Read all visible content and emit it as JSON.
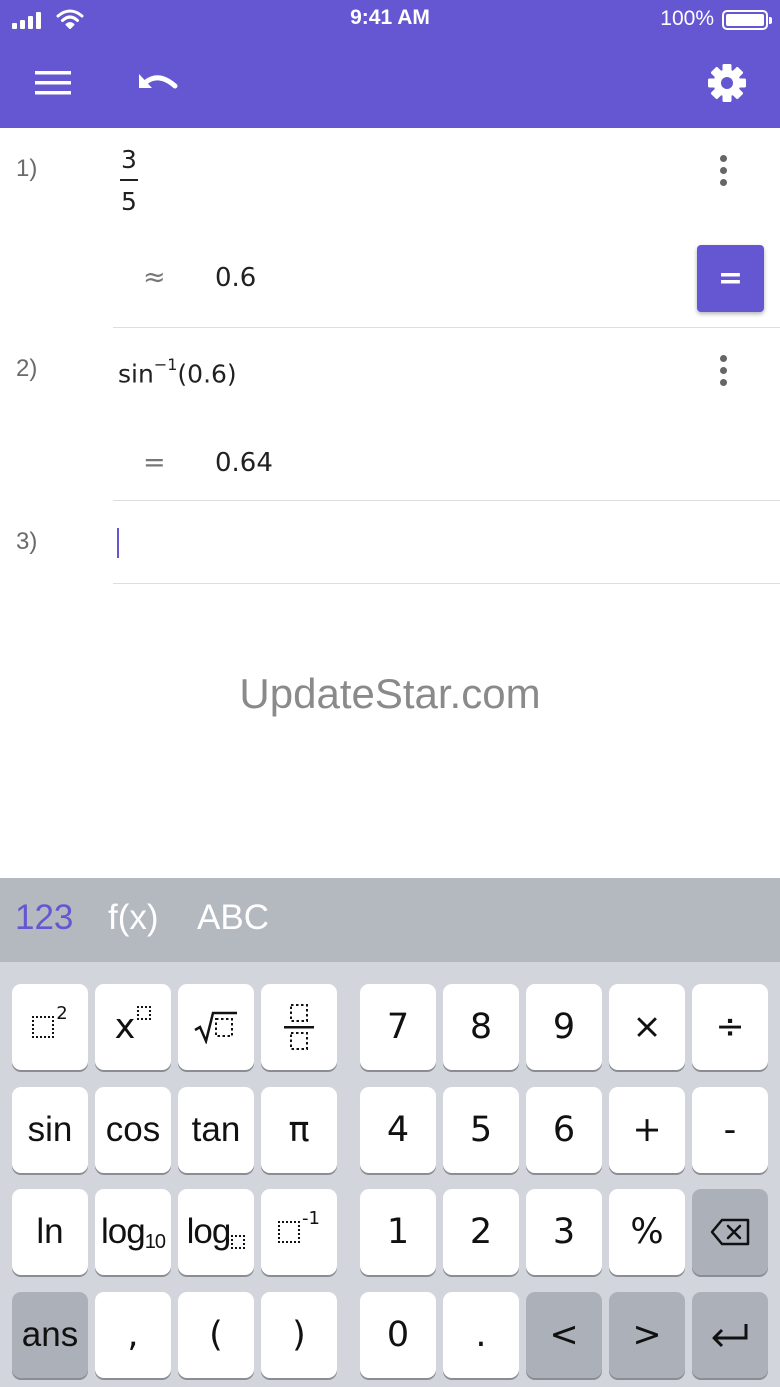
{
  "status_bar": {
    "time": "9:41 AM",
    "battery": "100%"
  },
  "toolbar": {
    "menu_icon": "hamburger-menu-icon",
    "undo_icon": "undo-icon",
    "settings_icon": "gear-icon"
  },
  "rows": [
    {
      "number": "1)",
      "numerator": "3",
      "denominator": "5",
      "relation": "≈",
      "output": "0.6",
      "toggle_label": "="
    },
    {
      "number": "2)",
      "func": "sin",
      "exponent": "−1",
      "argument": "(0.6)",
      "relation": "=",
      "output": "0.64"
    },
    {
      "number": "3)"
    }
  ],
  "watermark": "UpdateStar.com",
  "keyboard": {
    "tabs": [
      "123",
      "f(x)",
      "ABC"
    ],
    "active_tab": "123",
    "keys": {
      "square_sup": "2",
      "x": "x",
      "inverse_sup": "-1",
      "sin": "sin",
      "cos": "cos",
      "tan": "tan",
      "pi": "π",
      "ln": "ln",
      "log": "log",
      "log_base": "10",
      "ans": "ans",
      "comma": ",",
      "lparen": "(",
      "rparen": ")",
      "d7": "7",
      "d8": "8",
      "d9": "9",
      "times": "×",
      "divide": "÷",
      "d4": "4",
      "d5": "5",
      "d6": "6",
      "plus": "+",
      "minus": "-",
      "d1": "1",
      "d2": "2",
      "d3": "3",
      "percent": "%",
      "d0": "0",
      "dot": ".",
      "left": "<",
      "right": ">"
    }
  },
  "colors": {
    "accent": "#6557d2",
    "keyboard_bg": "#d2d5db",
    "tab_bar": "#b4b8bf"
  }
}
